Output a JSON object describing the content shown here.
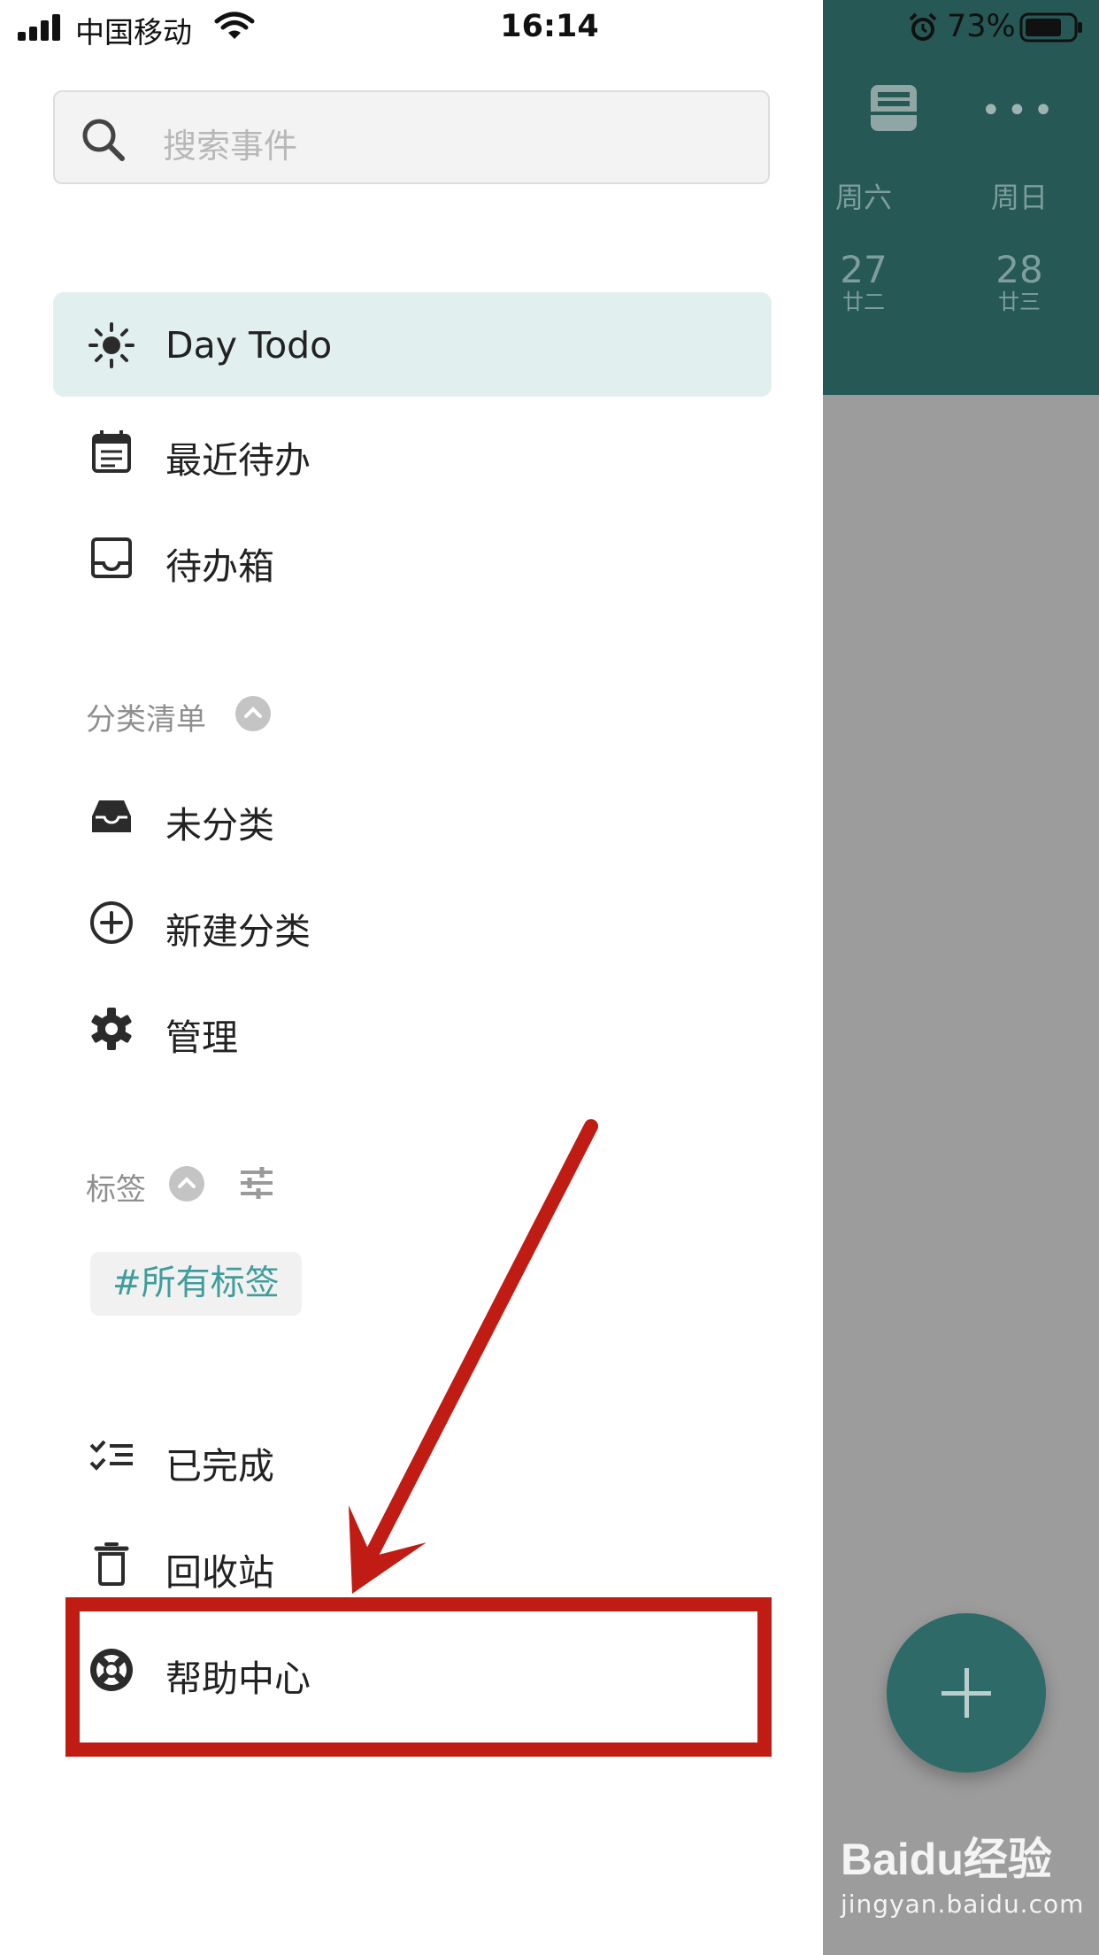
{
  "status_bar": {
    "carrier": "中国移动",
    "time": "16:14",
    "battery": "73%"
  },
  "search": {
    "placeholder": "搜索事件"
  },
  "nav": [
    {
      "label": "Day Todo",
      "icon": "sun-icon",
      "active": true
    },
    {
      "label": "最近待办",
      "icon": "calendar-icon"
    },
    {
      "label": "待办箱",
      "icon": "inbox-icon"
    }
  ],
  "categories": {
    "title": "分类清单",
    "items": [
      {
        "label": "未分类",
        "icon": "tray-icon"
      },
      {
        "label": "新建分类",
        "icon": "plus-circle-icon"
      },
      {
        "label": "管理",
        "icon": "gear-icon"
      }
    ]
  },
  "tags": {
    "title": "标签",
    "chip": "#所有标签"
  },
  "bottom": [
    {
      "label": "已完成",
      "icon": "checklist-icon"
    },
    {
      "label": "回收站",
      "icon": "trash-icon"
    },
    {
      "label": "帮助中心",
      "icon": "lifebuoy-icon"
    }
  ],
  "background_app": {
    "days": [
      {
        "weekday": "周六",
        "date": "27",
        "lunar": "廿二"
      },
      {
        "weekday": "周日",
        "date": "28",
        "lunar": "廿三"
      }
    ],
    "fab": "+",
    "watermark": {
      "logo": "Baidu经验",
      "url": "jingyan.baidu.com"
    }
  },
  "colors": {
    "accent": "#3f9d9a",
    "header": "#265856",
    "active_bg": "#e1f0ee",
    "highlight": "#c01c14"
  }
}
